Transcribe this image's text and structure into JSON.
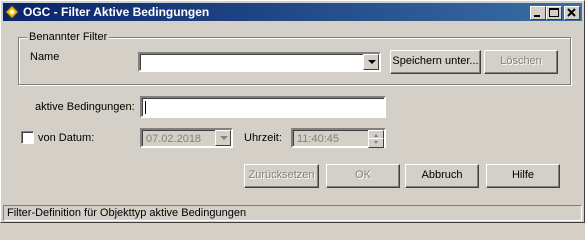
{
  "window": {
    "title": "OGC - Filter Aktive Bedingungen",
    "minimize_label": "_",
    "maximize_label": "□",
    "close_label": "✕"
  },
  "group": {
    "legend": "Benannter Filter",
    "name_label": "Name",
    "name_value": "",
    "save_label": "Speichern unter...",
    "delete_label": "Löschen"
  },
  "conditions": {
    "label": "aktive Bedingungen:",
    "value": ""
  },
  "date": {
    "checkbox_label": "von Datum:",
    "checked": false,
    "date_value": "07.02.2018",
    "time_label": "Uhrzeit:",
    "time_value": "11:40:45"
  },
  "buttons": {
    "reset_label": "Zurücksetzen",
    "ok_label": "OK",
    "cancel_label": "Abbruch",
    "help_label": "Hilfe"
  },
  "status_bar": {
    "text": "Filter-Definition für Objekttyp aktive Bedingungen"
  }
}
